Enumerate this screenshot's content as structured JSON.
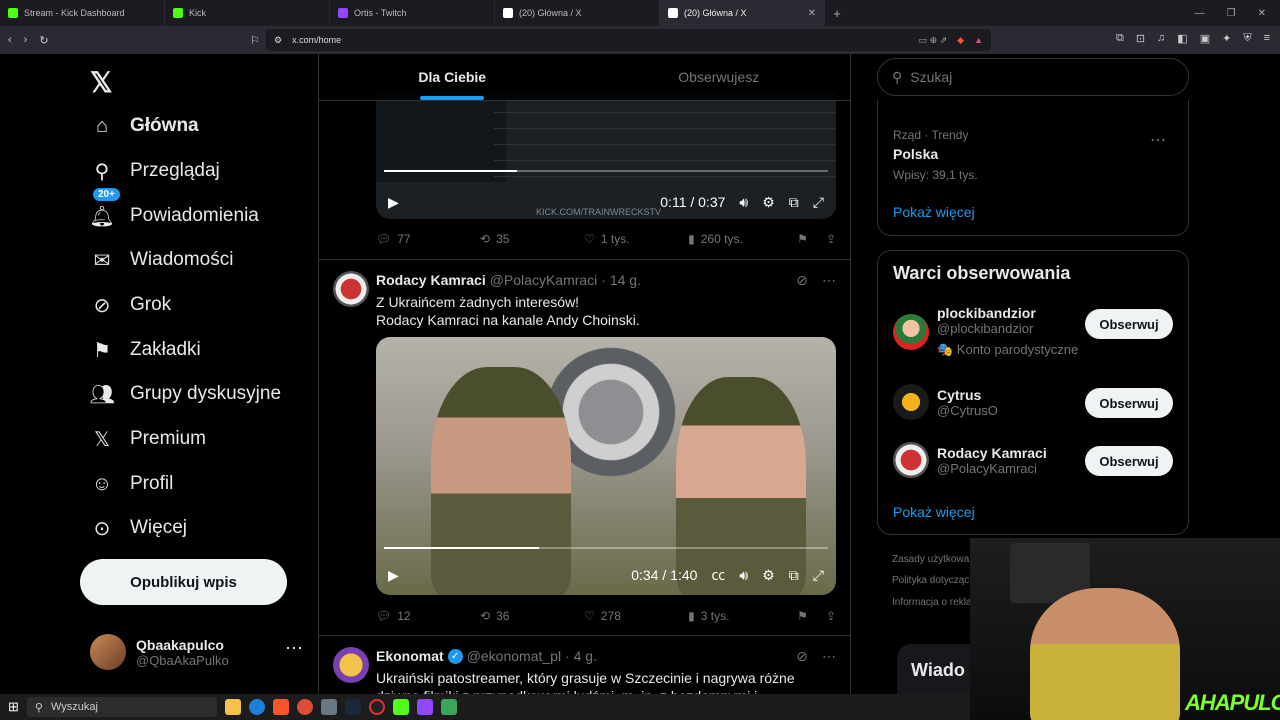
{
  "browser": {
    "tabs": [
      {
        "label": "Stream - Kick Dashboard",
        "color": "#53fc18",
        "active": false
      },
      {
        "label": "Kick",
        "color": "#53fc18",
        "active": false
      },
      {
        "label": "Ortis - Twitch",
        "color": "#9146ff",
        "active": false
      },
      {
        "label": "(20) Główna / X",
        "color": "#ffffff",
        "active": false
      },
      {
        "label": "(20) Główna / X",
        "color": "#ffffff",
        "active": true
      }
    ],
    "url": "x.com/home"
  },
  "sidebar": {
    "logo": "𝕏",
    "items": [
      {
        "label": "Główna",
        "icon": "home-icon",
        "glyph": "⌂"
      },
      {
        "label": "Przeglądaj",
        "icon": "search-icon",
        "glyph": "⚲"
      },
      {
        "label": "Powiadomienia",
        "icon": "bell-icon",
        "glyph": "🔔︎"
      },
      {
        "label": "Wiadomości",
        "icon": "mail-icon",
        "glyph": "✉"
      },
      {
        "label": "Grok",
        "icon": "grok-icon",
        "glyph": "⊘"
      },
      {
        "label": "Zakładki",
        "icon": "bookmark-icon",
        "glyph": "⚑"
      },
      {
        "label": "Grupy dyskusyjne",
        "icon": "communities-icon",
        "glyph": "👥︎"
      },
      {
        "label": "Premium",
        "icon": "x-premium-icon",
        "glyph": "𝕏"
      },
      {
        "label": "Profil",
        "icon": "profile-icon",
        "glyph": "☺"
      },
      {
        "label": "Więcej",
        "icon": "more-icon",
        "glyph": "⊙"
      }
    ],
    "badge": "20+",
    "post_button": "Opublikuj wpis",
    "account": {
      "name": "Qbaakapulco",
      "handle": "@QbaAkaPulko"
    }
  },
  "feed": {
    "tabs": [
      "Dla Ciebie",
      "Obserwujesz"
    ],
    "post1": {
      "video_time": "0:11 / 0:37",
      "watermark": "KICK.COM/TRAINWRECKSTV",
      "replies": "77",
      "reposts": "35",
      "likes": "1 tys.",
      "views": "260 tys."
    },
    "post2": {
      "name": "Rodacy Kamraci",
      "handle": "@PolacyKamraci",
      "time": "· 14 g.",
      "line1": "Z Ukraińcem żadnych interesów!",
      "line2": "Rodacy Kamraci na kanale Andy Choinski.",
      "video_time": "0:34 / 1:40",
      "replies": "12",
      "reposts": "36",
      "likes": "278",
      "views": "3 tys."
    },
    "post3": {
      "name": "Ekonomat",
      "handle": "@ekonomat_pl",
      "time": "· 4 g.",
      "text": "Ukraiński patostreamer, który grasuje w Szczecinie i nagrywa różne dziwne filmiki z przypadkowymi ludźmi, m. in. z bezdomnymi i uzależnionymi od"
    }
  },
  "right": {
    "search_placeholder": "Szukaj",
    "trend": {
      "meta": "Rząd · Trendy",
      "title": "Polska",
      "count": "Wpisy: 39,1 tys."
    },
    "show_more": "Pokaż więcej",
    "who_title": "Warci obserwowania",
    "who": [
      {
        "name": "plockibandzior",
        "handle": "@plockibandzior",
        "note": "🎭 Konto parodystyczne",
        "follow": "Obserwuj"
      },
      {
        "name": "Cytrus",
        "handle": "@CytrusO",
        "follow": "Obserwuj"
      },
      {
        "name": "Rodacy Kamraci",
        "handle": "@PolacyKamraci",
        "follow": "Obserwuj"
      }
    ],
    "footer": [
      "Zasady użytkowa",
      "Polityka dotycząc",
      "Informacja o rekla"
    ],
    "messages": "Wiado"
  },
  "webcam": {
    "overlay": "AHAPULCO"
  },
  "taskbar": {
    "search": "Wyszukaj"
  }
}
